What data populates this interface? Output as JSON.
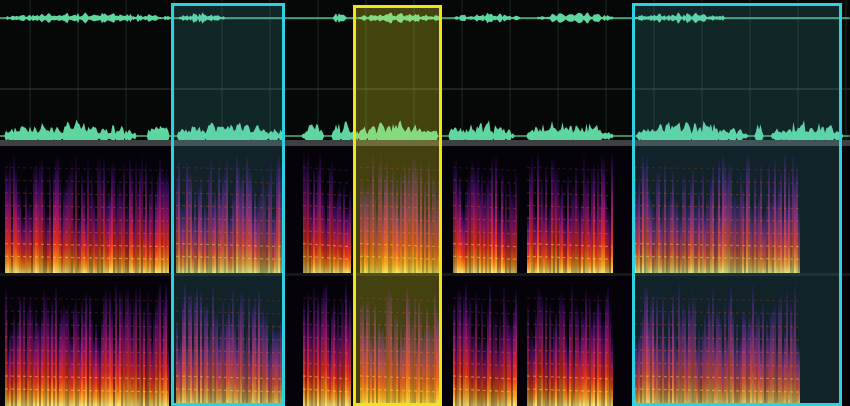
{
  "theme": {
    "waveform_color": "#5fd6a0",
    "selection_primary_color": "#2fd0e0",
    "selection_primary_tint": "rgba(80,200,210,0.16)",
    "selection_secondary_color": "#f2e21a",
    "selection_secondary_tint": "rgba(235,225,40,0.28)"
  },
  "selections": [
    {
      "id": "sel-a",
      "kind": "primary"
    },
    {
      "id": "sel-b",
      "kind": "secondary"
    },
    {
      "id": "sel-c",
      "kind": "primary"
    }
  ]
}
